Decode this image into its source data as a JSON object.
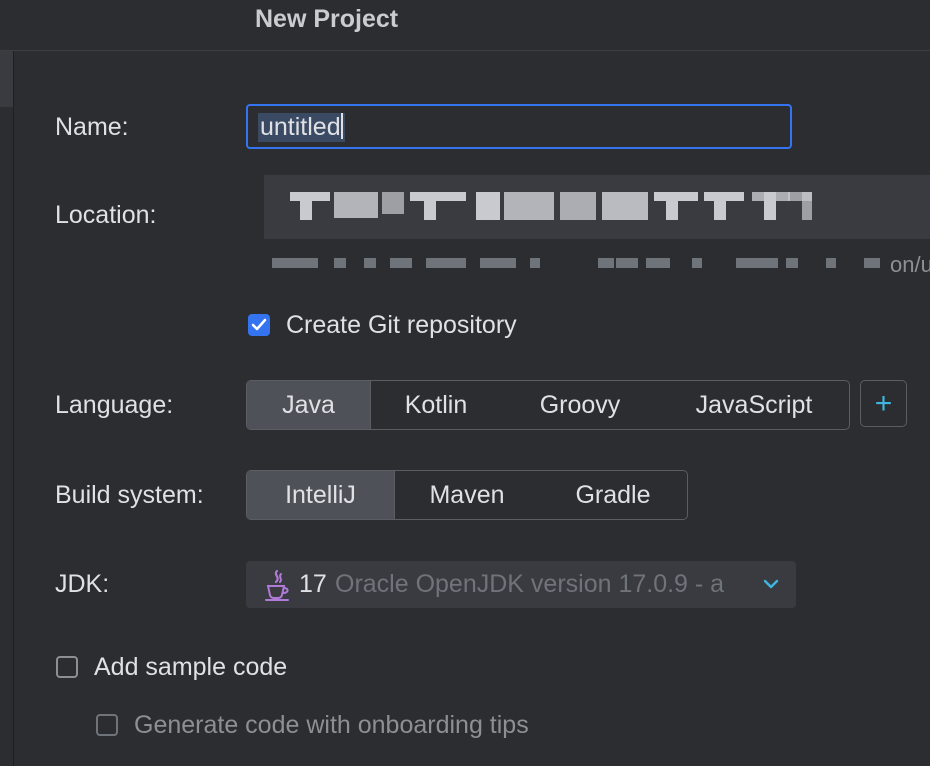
{
  "window": {
    "title": "New Project"
  },
  "form": {
    "name_label": "Name:",
    "name_value": "untitled",
    "location_label": "Location:",
    "location_suffix": "on/u",
    "git_checkbox_label": "Create Git repository",
    "git_checked": true,
    "language_label": "Language:",
    "languages": [
      "Java",
      "Kotlin",
      "Groovy",
      "JavaScript"
    ],
    "language_selected": "Java",
    "add_language_label": "+",
    "build_label": "Build system:",
    "build_systems": [
      "IntelliJ",
      "Maven",
      "Gradle"
    ],
    "build_selected": "IntelliJ",
    "jdk_label": "JDK:",
    "jdk_version": "17",
    "jdk_description": "Oracle OpenJDK version 17.0.9 - a",
    "jdk_icon": "java-cup-icon",
    "sample_code_label": "Add sample code",
    "sample_code_checked": false,
    "onboarding_label": "Generate code with onboarding tips",
    "onboarding_checked": false
  },
  "colors": {
    "background": "#2b2d30",
    "accent": "#3574f0",
    "plus": "#3fb6e0"
  }
}
